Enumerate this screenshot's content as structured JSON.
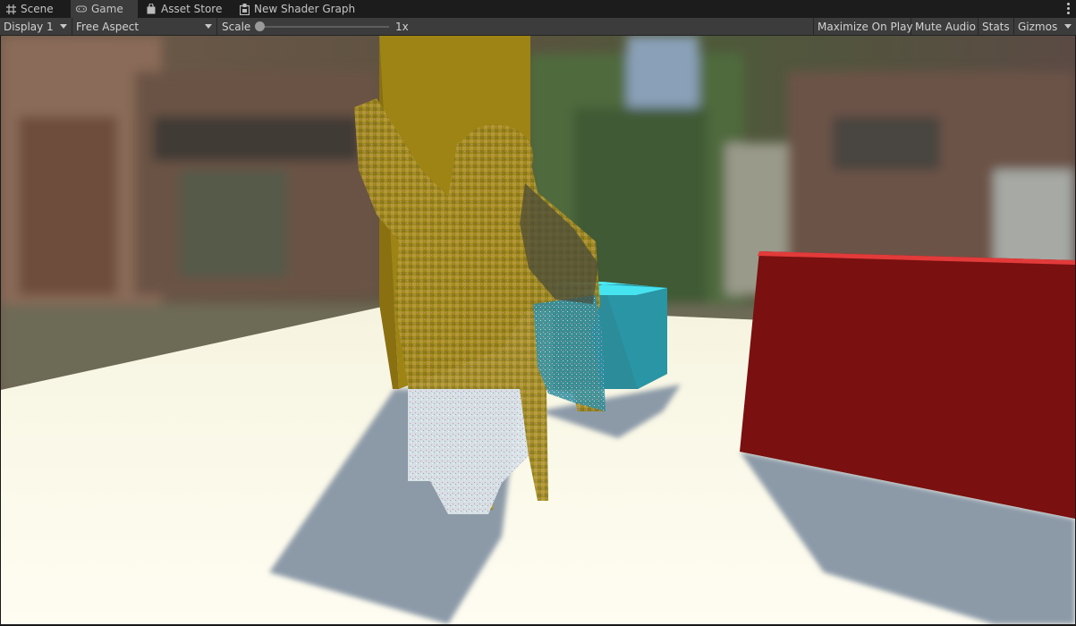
{
  "tabs": [
    {
      "label": "Scene",
      "icon": "grid-icon",
      "active": false
    },
    {
      "label": "Game",
      "icon": "gamepad-icon",
      "active": true
    },
    {
      "label": "Asset Store",
      "icon": "shopping-bag-icon",
      "active": false
    },
    {
      "label": "New Shader Graph",
      "icon": "shader-graph-icon",
      "active": false
    }
  ],
  "toolbar": {
    "display": "Display 1",
    "aspect": "Free Aspect",
    "scale_label": "Scale",
    "scale_value": "1x",
    "maximize_on_play": "Maximize On Play",
    "mute_audio": "Mute Audio",
    "stats": "Stats",
    "gizmos": "Gizmos"
  },
  "colors": {
    "editor_bg": "#3c3c3c",
    "floor": "#fcfbeb",
    "yellow_wall": "#9e8410",
    "red_wall": "#7a1010",
    "cyan_cube": "#2a8a98"
  }
}
